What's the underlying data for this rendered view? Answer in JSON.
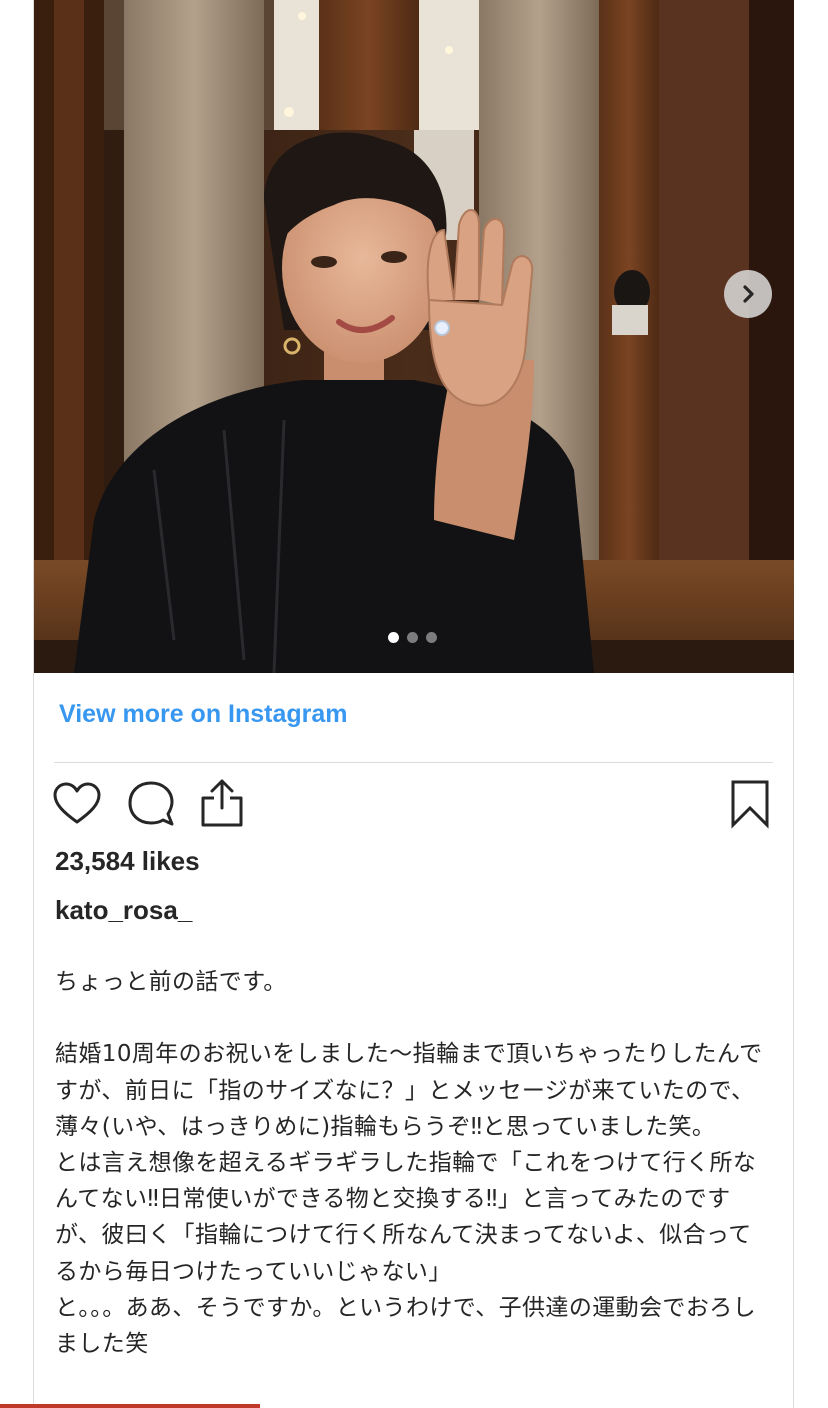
{
  "post": {
    "view_more_label": "View more on Instagram",
    "likes_text": "23,584 likes",
    "username": "kato_rosa_",
    "caption": "ちょっと前の話です。\n\n結婚10周年のお祝いをしました〜指輪まで頂いちゃったりしたんですが、前日に「指のサイズなに？」とメッセージが来ていたので、薄々(いや、はっきりめに)指輪もらうぞ‼︎と思っていました笑。\nとは言え想像を超えるギラギラした指輪で「これをつけて行く所なんてない‼︎日常使いができる物と交換する‼︎」と言ってみたのですが、彼曰く「指輪につけて行く所なんて決まってないよ、似合ってるから毎日つけたっていいじゃない」\nと。。。ああ、そうですか。というわけで、子供達の運動会でおろしました笑",
    "carousel": {
      "total_slides": 3,
      "active_slide": 1
    }
  },
  "icons": {
    "like": "heart-icon",
    "comment": "comment-icon",
    "share": "share-icon",
    "save": "bookmark-icon",
    "next": "chevron-right-icon"
  },
  "colors": {
    "link": "#3897f0",
    "text": "#262626",
    "border": "#dbdbdb"
  }
}
